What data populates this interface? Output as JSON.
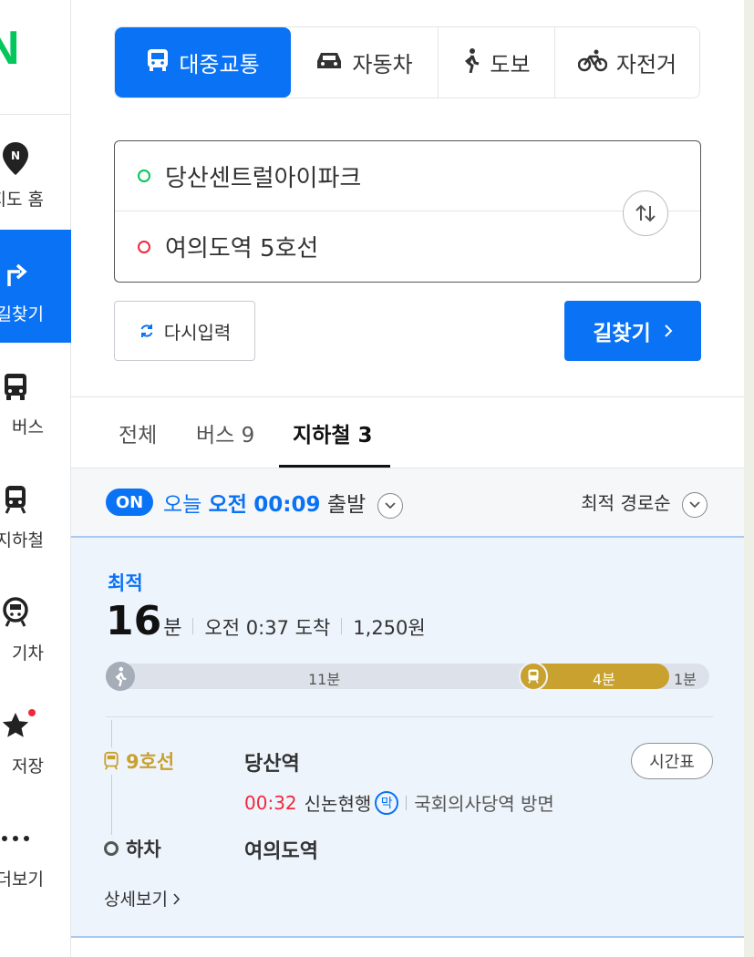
{
  "nav": {
    "logo": "N",
    "items": [
      {
        "label": "지도 홈",
        "icon": "map-pin-icon"
      },
      {
        "label": "길찾기",
        "icon": "directions-icon"
      },
      {
        "label": "버스",
        "icon": "bus-icon"
      },
      {
        "label": "지하철",
        "icon": "subway-icon"
      },
      {
        "label": "기차",
        "icon": "train-icon"
      },
      {
        "label": "저장",
        "icon": "star-icon"
      },
      {
        "label": "더보기",
        "icon": "more-icon"
      }
    ]
  },
  "modes": [
    {
      "label": "대중교통",
      "icon": "bus-icon"
    },
    {
      "label": "자동차",
      "icon": "car-icon"
    },
    {
      "label": "도보",
      "icon": "walk-icon"
    },
    {
      "label": "자전거",
      "icon": "bicycle-icon"
    }
  ],
  "route": {
    "origin": "당산센트럴아이파크",
    "destination": "여의도역 5호선"
  },
  "buttons": {
    "reset": "다시입력",
    "search": "길찾기"
  },
  "tabs": [
    {
      "label": "전체"
    },
    {
      "label": "버스 9"
    },
    {
      "label": "지하철 3"
    }
  ],
  "sortbar": {
    "badge": "ON",
    "today": "오늘",
    "ampm": "오전",
    "time": "00:09",
    "depart": "출발",
    "sort": "최적 경로순"
  },
  "result": {
    "tag": "최적",
    "minutes": "16",
    "unit": "분",
    "arrival": "오전 0:37 도착",
    "fare": "1,250원",
    "segments": {
      "walk": "11분",
      "subway": "4분",
      "walk_end": "1분"
    },
    "line": "9호선",
    "board_station": "당산역",
    "timetable": "시간표",
    "dep_time": "00:32",
    "direction": "신논현행",
    "last_train": "막",
    "platform": "국회의사당역 방면",
    "getoff": "하차",
    "alight_station": "여의도역",
    "details": "상세보기"
  }
}
